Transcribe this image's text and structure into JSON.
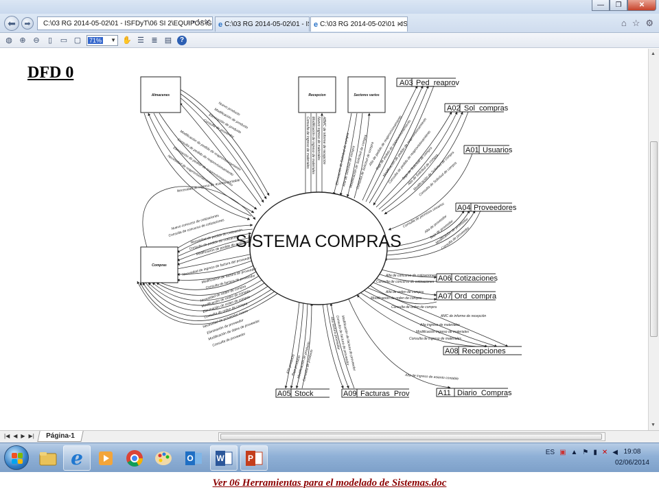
{
  "window": {
    "controls": {
      "minimize": "—",
      "maximize": "❐",
      "close": "✕"
    }
  },
  "navbar": {
    "address_text": "C:\\03 RG 2014-05-02\\01 - ISFDyT\\06 SI 2\\EQUIPOS\\Gru",
    "tabs": [
      {
        "label": "C:\\03 RG 2014-05-02\\01 - ISFD..."
      },
      {
        "label": "C:\\03 RG 2014-05-02\\01 - IS..."
      }
    ],
    "close_tab_glyph": "✕"
  },
  "toolbar": {
    "zoom_value": "71%"
  },
  "document": {
    "heading": "DFD 0",
    "process": "SISTEMA COMPRAS",
    "entities": [
      "Almacenes",
      "Recepcion",
      "Sectores varios",
      "Compras"
    ],
    "stores": {
      "a03": {
        "id": "A03",
        "name": "Ped_reaprov"
      },
      "a02": {
        "id": "A02",
        "name": "Sol_compras"
      },
      "a01": {
        "id": "A01",
        "name": "Usuarios"
      },
      "a04": {
        "id": "A04",
        "name": "Proveedores"
      },
      "a06": {
        "id": "A06",
        "name": "Cotizaciones"
      },
      "a07": {
        "id": "A07",
        "name": "Ord_compra"
      },
      "a08": {
        "id": "A08",
        "name": "Recepciones"
      },
      "a05": {
        "id": "A05",
        "name": "Stock"
      },
      "a09": {
        "id": "A09",
        "name": "Facturas_Prov"
      },
      "a11": {
        "id": "A11",
        "name": "Diario_Compras"
      }
    },
    "flows": {
      "almacenes": [
        "Nuevo producto",
        "Modificación de producto",
        "Eliminación de producto",
        "Consulta de proveedor",
        "Modificación de pedido de reaprovisionamiento",
        "Consulta de pedido de reaprovisionamiento",
        "Eliminación de pedido de reaprovisionamiento",
        "Necesidad de reaprovisionamiento"
      ],
      "recepcion": [
        "ABMC de informe de recepción",
        "Nuevo ingreso de materiales",
        "Modificación de ingreso de materiales",
        "Consulta de ingreso de materiales"
      ],
      "sectores": [
        "Eliminación de Solicitud de compra",
        "Alta de Solicitud de compra",
        "Modificación de Solicitud de compra",
        "Consulta de Solicitud de compra"
      ],
      "compras": [
        "Necesidad de ingreso de asiento contable",
        "Nuevo concurso de cotizaciones",
        "Consulta de concurso de cotizaciones",
        "Necesidad de pedido de cotización",
        "Consulta de pedido de cotización",
        "Modificación de pedido de cotización",
        "Necesidad de ingreso de factura del proveedor",
        "Modificación de factura de proveedor",
        "Consulta de factura de proveedor",
        "Necesidad de orden de compra",
        "Modificación de orden de compra",
        "Eliminación de orden de compra",
        "Consulta de orden de compra",
        "Necesidad de proveedor nuevo",
        "Eliminación de proveedor",
        "Modificación de datos de proveedor",
        "Consulta de proveedor"
      ],
      "a03": [
        "Alta de pedido de reaprovisionamiento",
        "Baja de pedido de reaprovisionamiento",
        "Modificación de pedido de reaprovisionamiento",
        "Consulta de pedido de reaprovisionamiento"
      ],
      "a02": [
        "Baja de Solicitud de compra",
        "Alta de Solicitud de compra",
        "Modificación de Solicitud de compra",
        "Consulta de Solicitud de compra"
      ],
      "a01": [
        "Consulta de permisos usuarios"
      ],
      "a04": [
        "Alta de proveedor",
        "Baja de proveedor",
        "Modificación de proveedor",
        "Consulta de proveedor"
      ],
      "a06": [
        "Alta de concurso de cotizaciones",
        "Consulta de concurso de cotizaciones"
      ],
      "a07": [
        "Alta de orden de compra",
        "Modificación de orden de compra",
        "Consulta de orden de compra"
      ],
      "a08": [
        "AMC de informe de recepción",
        "Alta ingreso de materiales",
        "Modificación ingreso de materiales",
        "Consulta de ingreso de materiales"
      ],
      "a05": [
        "Alta producto",
        "Baja producto",
        "Modificación de producto",
        "Consulta de producto"
      ],
      "a09": [
        "Alta factura proveedor",
        "Consulta de factura de proveedor",
        "Modificación de factura de proveedor"
      ],
      "a11": [
        "Alta de ingreso de asiento contable"
      ]
    }
  },
  "sheetbar": {
    "tab_label": "Página-1",
    "nav_glyphs": [
      "|◀",
      "◀",
      "▶",
      "▶|"
    ]
  },
  "taskbar": {
    "language": "ES",
    "time": "19:08",
    "date": "02/06/2014"
  },
  "footer": {
    "caption": "Ver 06 Herramientas para el modelado de Sistemas.doc"
  },
  "colors": {
    "footer_text": "#8b0000",
    "taskbar": "#8fb0d6",
    "titlebar": "#dbe6f4"
  }
}
